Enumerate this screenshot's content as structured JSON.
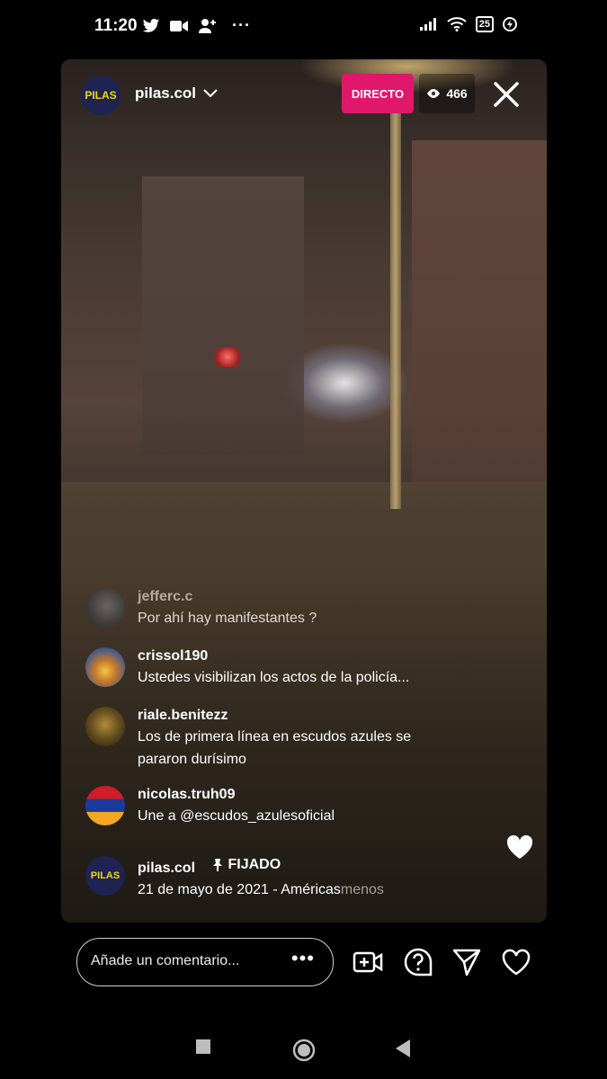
{
  "status_bar": {
    "time": "11:20",
    "left_icons": [
      "twitter-icon",
      "video-icon",
      "person-add-icon",
      "more-icon"
    ],
    "right_icons": [
      "signal-icon",
      "wifi-icon",
      "battery-icon",
      "data-saver-icon"
    ],
    "battery_level": "25"
  },
  "live": {
    "username": "pilas.col",
    "avatar_text": "PILAS",
    "live_badge": "DIRECTO",
    "viewer_count": "466"
  },
  "comments": [
    {
      "username": "jefferc.c",
      "text": "Por ahí hay manifestantes ?"
    },
    {
      "username": "crissol190",
      "text": "Ustedes visibilizan los actos de la policía..."
    },
    {
      "username": "riale.benitezz",
      "text": "Los de primera línea en escudos azules se pararon durísimo"
    },
    {
      "username": "nicolas.truh09",
      "text": "Une a @escudos_azulesoficial"
    }
  ],
  "pinned": {
    "username": "pilas.col",
    "avatar_text": "PILAS",
    "pinned_label": "FIJADO",
    "text": "21 de mayo de 2021 - Américas",
    "more_label": "menos"
  },
  "composer": {
    "placeholder": "Añade un comentario...",
    "dots": "•••"
  }
}
